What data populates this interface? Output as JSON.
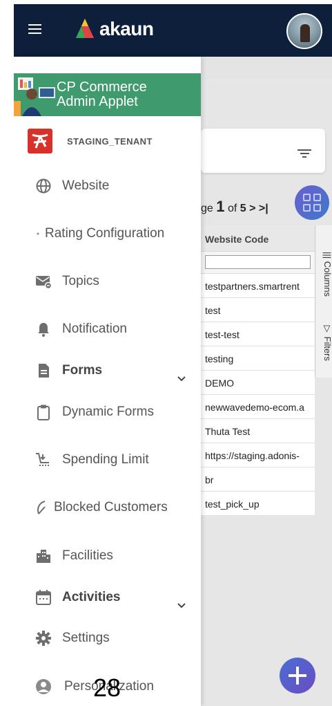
{
  "header": {
    "brand": "akaun",
    "icons": [
      "menu-icon",
      "akaun-logo",
      "user-avatar"
    ]
  },
  "applet": {
    "title_line1": "CP Commerce",
    "title_line2": "Admin Applet"
  },
  "tenant": {
    "label": "STAGING_TENANT"
  },
  "nav": {
    "items": [
      {
        "label": "Website",
        "icon": "globe-icon",
        "bold": false
      },
      {
        "label": "Rating Configuration",
        "icon": "dot-icon",
        "bold": false
      },
      {
        "label": "Topics",
        "icon": "mail-icon",
        "bold": false
      },
      {
        "label": "Notification",
        "icon": "bell-icon",
        "bold": false
      },
      {
        "label": "Forms",
        "icon": "document-icon",
        "bold": true,
        "expandable": true
      },
      {
        "label": "Dynamic Forms",
        "icon": "clipboard-icon",
        "bold": false
      },
      {
        "label": "Spending Limit",
        "icon": "cart-icon",
        "bold": false
      },
      {
        "label": "Blocked Customers",
        "icon": "blocked-icon",
        "bold": false
      },
      {
        "label": "Facilities",
        "icon": "building-icon",
        "bold": false
      },
      {
        "label": "Activities",
        "icon": "calendar-icon",
        "bold": true,
        "expandable": true
      },
      {
        "label": "Settings",
        "icon": "gear-icon",
        "bold": false
      },
      {
        "label": "Personalization",
        "icon": "person-icon",
        "bold": false
      }
    ]
  },
  "background": {
    "pager": {
      "prefix": "ge",
      "current": "1",
      "of": "of",
      "total": "5",
      "next": ">",
      "last": ">|"
    },
    "table": {
      "column": "Website Code",
      "rows": [
        "testpartners.smartrent",
        "test",
        "test-test",
        "testing",
        "DEMO",
        "newwavedemo-ecom.a",
        "Thuta Test",
        "https://staging.adonis-",
        "br",
        "test_pick_up"
      ]
    },
    "side_tabs": {
      "columns": "Columns",
      "filters": "Filters"
    }
  },
  "page_number": "28",
  "colors": {
    "topbar": "#0d1f3a",
    "applet": "#3f9a6e",
    "tenant_logo": "#d7322a",
    "fab": "#4a6ed4"
  }
}
